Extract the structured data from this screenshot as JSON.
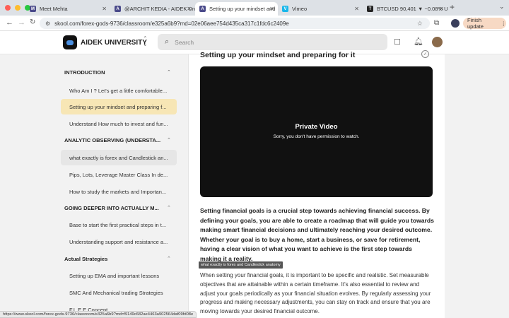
{
  "browser": {
    "tabs": [
      {
        "label": "Meet Mehta",
        "fav_color": "#4a4a8a",
        "fav_text": "M"
      },
      {
        "label": "@ARCHIT KEDIA - AIDEK Uni",
        "fav_color": "#4a4a8a",
        "fav_text": "A"
      },
      {
        "label": "Setting up your mindset and",
        "fav_color": "#4a4a8a",
        "fav_text": "A"
      },
      {
        "label": "Vimeo",
        "fav_color": "#1ab7ea",
        "fav_text": "V"
      },
      {
        "label": "BTCUSD 90,401 ▼ −0.08% U",
        "fav_color": "#222222",
        "fav_text": "T"
      }
    ],
    "url": "skool.com/forex-gods-9736/classroom/e325a6b9?md=02e06aee754d435ca317c1fdc6c2409e",
    "finish_update": "Finish update",
    "status_url": "https://www.skool.com/forex-gods-9736/classroom/e325a6b9?md=f9149c682ae4463a902564daf09fd08e"
  },
  "header": {
    "brand": "AIDEK UNIVERSITY",
    "search_placeholder": "Search"
  },
  "sidebar": {
    "sections": [
      {
        "title": "INTRODUCTION",
        "items": [
          "Who Am I ? Let's get a little comfortable...",
          "Setting up your mindset and preparing f...",
          "Understand How much to invest and fun..."
        ]
      },
      {
        "title": "ANALYTIC OBSERVING (UNDERSTA...",
        "items": [
          "what exactly is forex and Candlestick an...",
          "Pips, Lots, Leverage Master Class In de...",
          "How to study the markets and Importan..."
        ]
      },
      {
        "title": "GOING DEEPER INTO ACTUALLY M...",
        "items": [
          "Base to start the first practical steps in t...",
          "Understanding support and resistance a..."
        ]
      },
      {
        "title": "Actual Strategies",
        "items": [
          "Setting up EMA and important lessons",
          "SMC And Mechanical trading Strategies",
          "F.L.E.E Concept"
        ]
      }
    ]
  },
  "content": {
    "title": "Setting up your mindset and preparing for it",
    "video_title": "Private Video",
    "video_message": "Sorry, you don't have permission to watch.",
    "bold_paragraph": "Setting financial goals is a crucial step towards achieving financial success. By defining your goals, you are able to create a roadmap that will guide you towards making smart financial decisions and ultimately reaching your desired outcome. Whether your goal is to buy a home, start a business, or save for retirement, having a clear vision of what you want to achieve is the first step towards making it a reality.",
    "tooltip": "what exactly is forex and Candlestick anatomy",
    "paragraph": "When setting your financial goals, it is important to be specific and realistic. Set measurable objectives that are attainable within a certain timeframe. It's also essential to review and adjust your goals periodically as your financial situation evolves. By regularly assessing your progress and making necessary adjustments, you can stay on track and ensure that you are moving towards your desired financial outcome."
  }
}
